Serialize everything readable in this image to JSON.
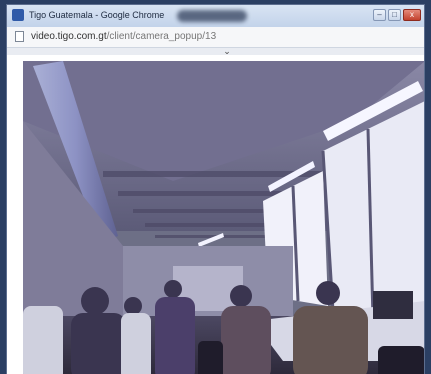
{
  "window": {
    "title": "Tigo Guatemala - Google Chrome",
    "controls": {
      "minimize": "–",
      "maximize": "□",
      "close": "x"
    }
  },
  "address": {
    "url_host": "video.tigo.com.gt",
    "url_path": "/client/camera_popup/13"
  },
  "icons": {
    "app": "chrome-app-icon",
    "page": "page-icon",
    "expand": "chevron-down-icon"
  },
  "colors": {
    "desktop": "#2b3f63",
    "window_frame": "#c3d3ea",
    "close_button": "#c2412e"
  }
}
